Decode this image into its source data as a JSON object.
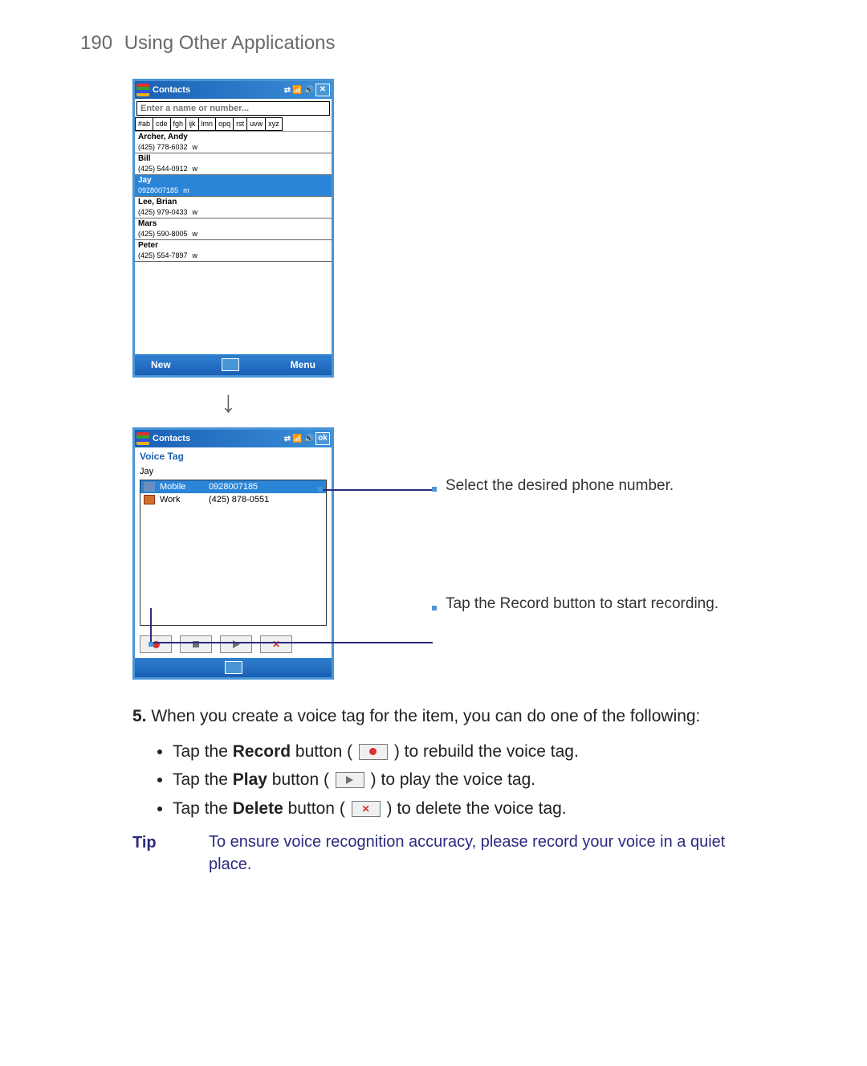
{
  "header": {
    "page_number": "190",
    "title": "Using Other Applications"
  },
  "phone1": {
    "titlebar": {
      "title": "Contacts",
      "close_label": "✕"
    },
    "search_placeholder": "Enter a name or number...",
    "letter_tabs": [
      "#ab",
      "cde",
      "fgh",
      "ijk",
      "lmn",
      "opq",
      "rst",
      "uvw",
      "xyz"
    ],
    "contacts": [
      {
        "name": "Archer, Andy",
        "phone": "(425) 778-6032",
        "type": "w",
        "selected": false
      },
      {
        "name": "Bill",
        "phone": "(425) 544-0912",
        "type": "w",
        "selected": false
      },
      {
        "name": "Jay",
        "phone": "0928007185",
        "type": "m",
        "selected": true
      },
      {
        "name": "Lee, Brian",
        "phone": "(425) 979-0433",
        "type": "w",
        "selected": false
      },
      {
        "name": "Mars",
        "phone": "(425) 590-8005",
        "type": "w",
        "selected": false
      },
      {
        "name": "Peter",
        "phone": "(425) 554-7897",
        "type": "w",
        "selected": false
      }
    ],
    "bottombar": {
      "left": "New",
      "right": "Menu"
    }
  },
  "phone2": {
    "titlebar": {
      "title": "Contacts",
      "ok_label": "ok"
    },
    "subtitle": "Voice Tag",
    "contact_name": "Jay",
    "entries": [
      {
        "icon": "mobile",
        "label": "Mobile",
        "number": "0928007185",
        "selected": true
      },
      {
        "icon": "work",
        "label": "Work",
        "number": "(425) 878-0551",
        "selected": false
      }
    ]
  },
  "annotations": {
    "select_number": "Select the desired phone number.",
    "tap_record": "Tap the Record button to start recording."
  },
  "instructions": {
    "step_num": "5.",
    "step_text": "When you create a voice tag for the item, you can do one of the following:",
    "bullets": [
      {
        "prefix": "Tap the ",
        "bold": "Record",
        "mid": " button ( ",
        "icon": "record",
        "suffix": " ) to rebuild the voice tag."
      },
      {
        "prefix": "Tap the ",
        "bold": "Play",
        "mid": " button ( ",
        "icon": "play",
        "suffix": " ) to play the voice tag."
      },
      {
        "prefix": "Tap the ",
        "bold": "Delete",
        "mid": " button ( ",
        "icon": "delete",
        "suffix": " ) to delete the voice tag."
      }
    ],
    "tip_label": "Tip",
    "tip_text": "To ensure voice recognition accuracy, please record your voice in a quiet place."
  }
}
